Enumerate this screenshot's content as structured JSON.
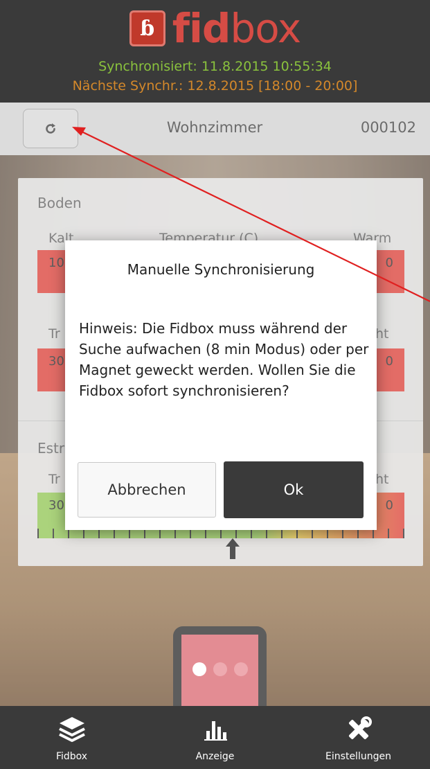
{
  "header": {
    "logo_mark": "ɓ",
    "logo_fid": "fid",
    "logo_box": "box",
    "sync_status": "Synchronisiert: 11.8.2015 10:55:34",
    "next_sync": "Nächste Synchr.: 12.8.2015 [18:00 - 20:00]"
  },
  "roombar": {
    "room_name": "Wohnzimmer",
    "room_id": "000102",
    "refresh_icon": "refresh-icon"
  },
  "card": {
    "section1": "Boden",
    "row1_left": "Kalt",
    "row1_center": "Temperatur (C)",
    "row1_right": "Warm",
    "row1_min": "10",
    "row1_max": "0",
    "row2_left": "Tr",
    "row2_right": "ht",
    "row2_min": "30",
    "row2_max": "0",
    "section2": "Estr",
    "row3_left": "Tr",
    "row3_right": "ht",
    "row3_min": "30",
    "row3_max": "0"
  },
  "modal": {
    "title": "Manuelle Synchronisierung",
    "body": "Hinweis: Die Fidbox muss während der Suche aufwachen (8 min Modus) oder per Magnet geweckt werden. Wollen Sie die Fidbox sofort synchronisieren?",
    "cancel_label": "Abbrechen",
    "ok_label": "Ok"
  },
  "bottom_nav": {
    "items": [
      {
        "label": "Fidbox",
        "icon": "layers-icon"
      },
      {
        "label": "Anzeige",
        "icon": "bar-chart-icon"
      },
      {
        "label": "Einstellungen",
        "icon": "tools-icon"
      }
    ]
  },
  "colors": {
    "header_bg": "#3a3a3a",
    "sync_green": "#8ac23d",
    "sync_orange": "#d4882a",
    "brand_red": "#d64c45",
    "gauge_red": "#d9342b",
    "gauge_green": "#8bc34a",
    "annotation_red": "#e02020"
  }
}
